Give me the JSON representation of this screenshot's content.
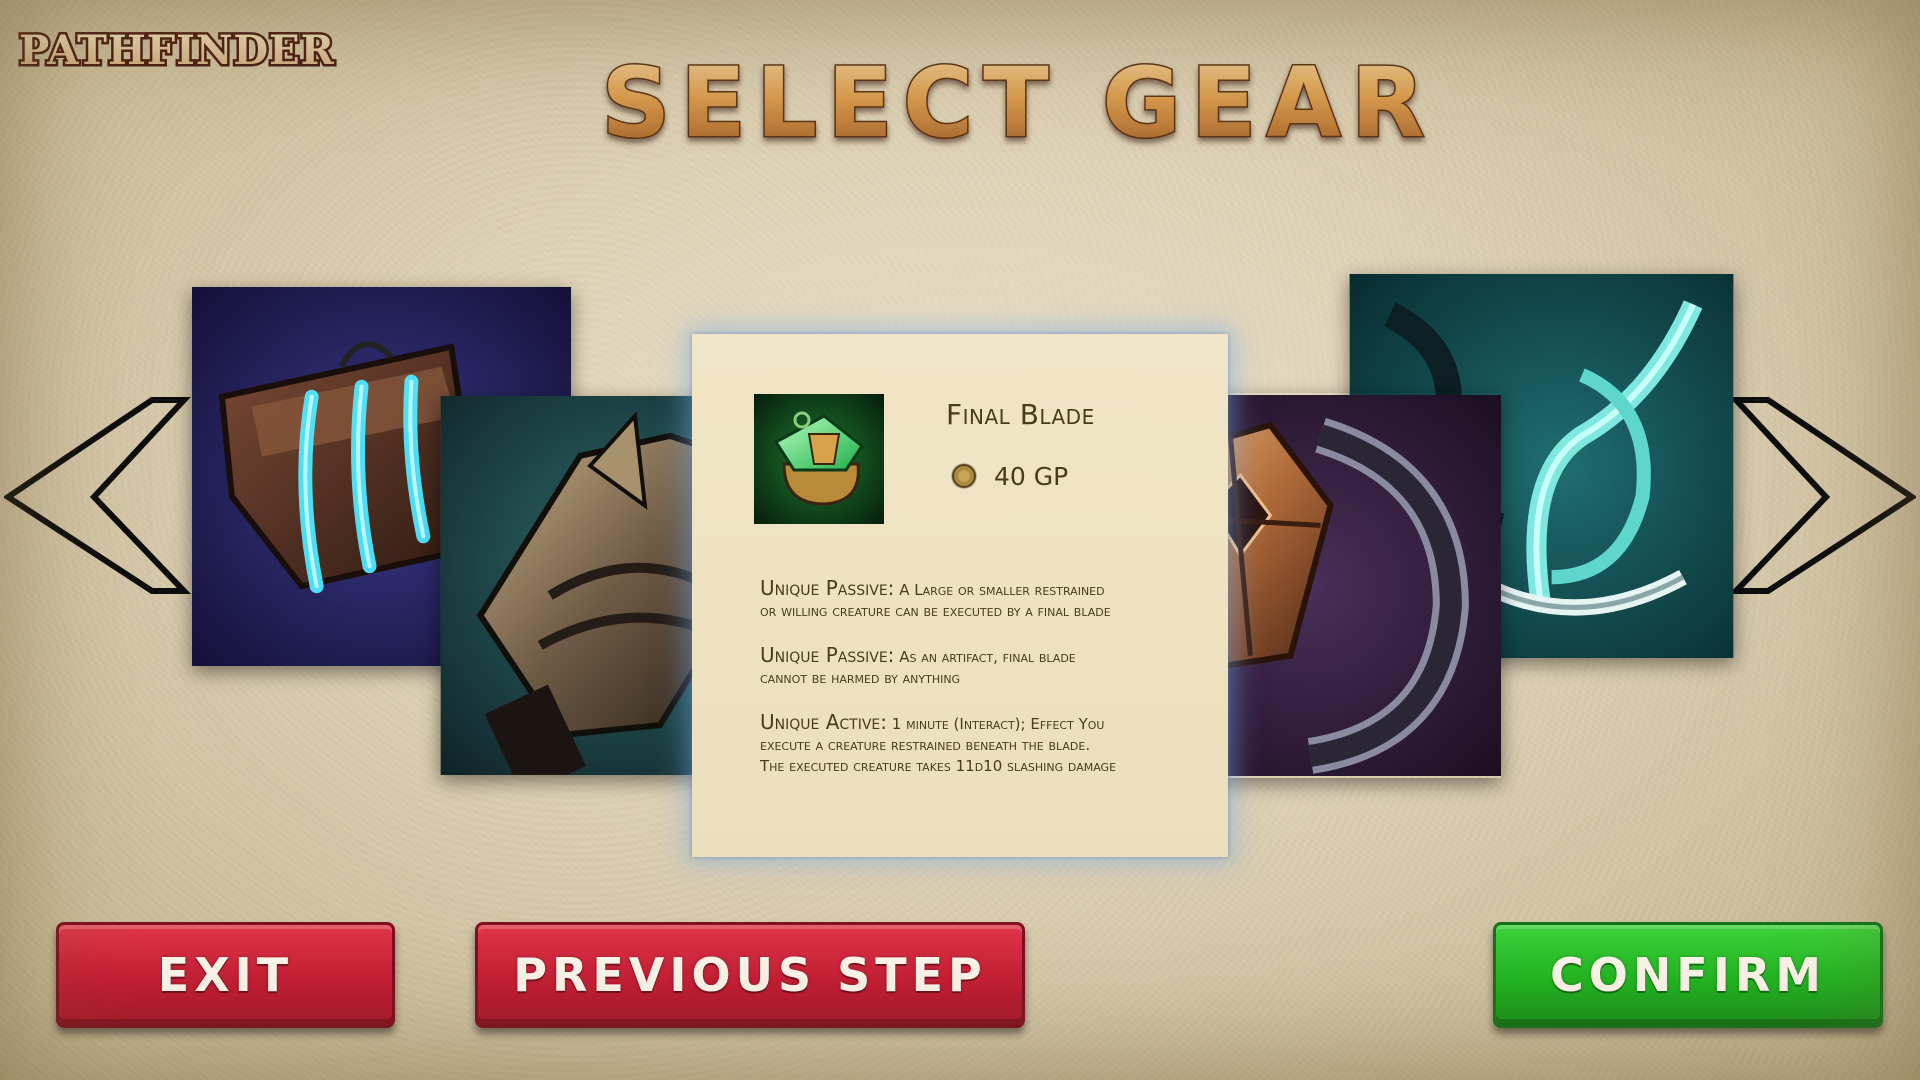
{
  "brand": {
    "logo_text": "PATHFINDER"
  },
  "header": {
    "title": "SELECT GEAR"
  },
  "carousel": {
    "prev_icon": "chevron-left-icon",
    "next_icon": "chevron-right-icon",
    "tiles": [
      {
        "name": "clawed-bracer-icon"
      },
      {
        "name": "spiked-axe-icon"
      },
      {
        "name": "crested-gauntlet-icon"
      },
      {
        "name": "spectral-scythe-icon"
      }
    ]
  },
  "item": {
    "icon": "emerald-amulet-icon",
    "name": "Final Blade",
    "price": "40 GP",
    "coin_icon": "gold-coin-icon",
    "abilities": [
      {
        "label": "Unique Passive:",
        "text_lines": [
          "A Large or smaller restrained",
          "or willing creature can be executed by a final blade"
        ]
      },
      {
        "label": "Unique Passive:",
        "text_lines": [
          "As an artifact, final blade",
          "cannot be harmed by anything"
        ]
      },
      {
        "label": "Unique Active:",
        "text_lines": [
          "1 minute (Interact); Effect You",
          "execute a creature restrained beneath the blade.",
          "The executed creature takes 11d10 slashing damage"
        ]
      }
    ]
  },
  "buttons": {
    "exit": "EXIT",
    "previous": "PREVIOUS STEP",
    "confirm": "CONFIRM"
  },
  "colors": {
    "parchment": "#d4c7a8",
    "card": "#ecdfbd",
    "red_button": "#c41d33",
    "green_button": "#21b521",
    "title_gold": "#c98a3a",
    "card_glow": "#78aae6"
  }
}
